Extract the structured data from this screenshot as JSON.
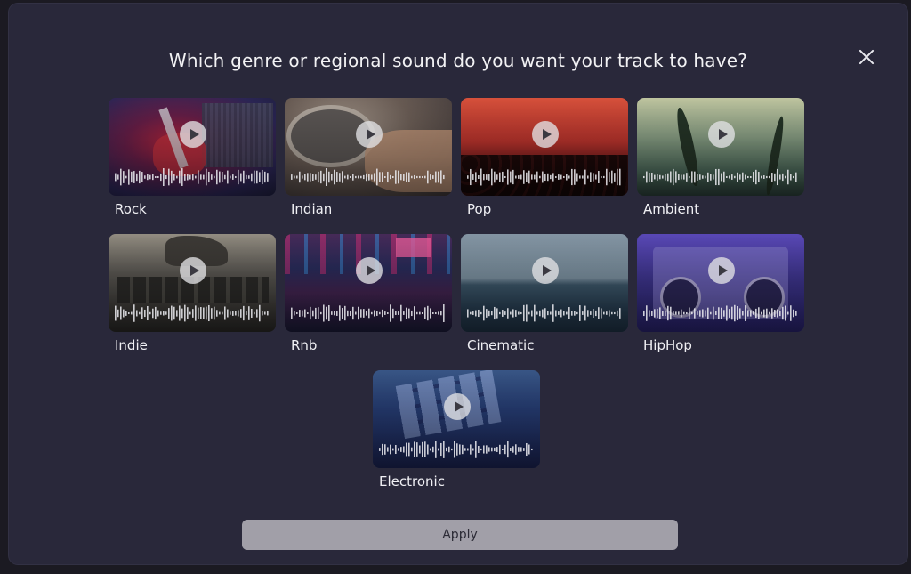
{
  "dialog": {
    "title": "Which genre or regional sound do you want your track to have?",
    "apply_label": "Apply"
  },
  "genres": [
    {
      "label": "Rock"
    },
    {
      "label": "Indian"
    },
    {
      "label": "Pop"
    },
    {
      "label": "Ambient"
    },
    {
      "label": "Indie"
    },
    {
      "label": "Rnb"
    },
    {
      "label": "Cinematic"
    },
    {
      "label": "HipHop"
    },
    {
      "label": "Electronic"
    }
  ],
  "icons": {
    "close": "close-icon",
    "play": "play-icon",
    "waveform": "waveform-icon"
  },
  "colors": {
    "modal_bg": "#29283a",
    "page_bg": "#1b1a22",
    "apply_button": "#a19fa8",
    "text": "#f0f0f4"
  }
}
